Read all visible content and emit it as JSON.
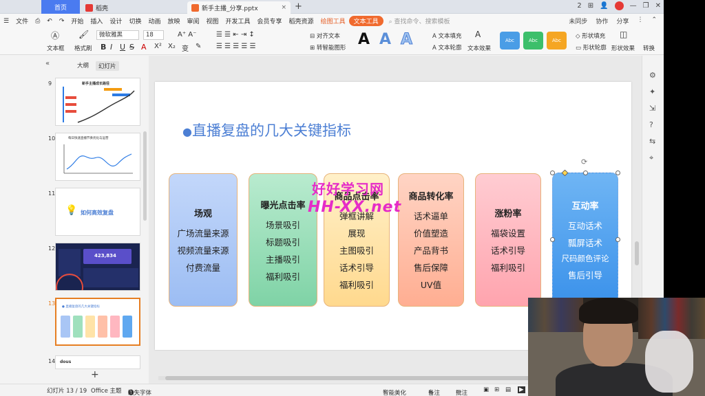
{
  "tabs": {
    "home": "首页",
    "daoke": "稻壳",
    "file": "新手主播_分享.pptx"
  },
  "titlebar_right": [
    "2",
    "⊞"
  ],
  "menu": {
    "file": "文件",
    "items": [
      "开始",
      "插入",
      "设计",
      "切换",
      "动画",
      "放映",
      "审阅",
      "视图",
      "开发工具",
      "会员专享",
      "稻壳资源"
    ],
    "draw_tools": "绘图工具",
    "text_tools": "文本工具",
    "search": "查找命令、搜索模板",
    "unsynced": "未同步",
    "collab": "协作",
    "share": "分享"
  },
  "ribbon": {
    "textbox": "文本框",
    "format_brush": "格式刷",
    "font_name": "微软雅黑",
    "font_size": "18",
    "align_text": "对齐文本",
    "smartart": "转智能图形",
    "text_fill": "文本填充",
    "text_outline": "文本轮廓",
    "text_effect": "文本效果",
    "abc": "Abc",
    "shape_fill": "形状填充",
    "shape_outline": "形状轮廓",
    "shape_effect": "形状效果",
    "convert": "转换",
    "bold": "B",
    "italic": "I",
    "underline": "U",
    "strike": "S",
    "fontcolor": "A",
    "superscript": "X²",
    "subscript": "X₂",
    "bigA": "A"
  },
  "leftpanel": {
    "outline_tab": "大纲",
    "slides_tab": "幻灯片",
    "slides": [
      {
        "num": "9",
        "title": "新手主播成长路径"
      },
      {
        "num": "10",
        "title": "每日快速直播节奏优化与运营"
      },
      {
        "num": "11",
        "title": "如何高效复盘"
      },
      {
        "num": "12",
        "title": "423,834"
      },
      {
        "num": "13",
        "title": "● 直播复盘的几大关键指标"
      },
      {
        "num": "14",
        "title": "dous"
      }
    ]
  },
  "slide": {
    "title": "直播复盘的几大关键指标",
    "cards": [
      {
        "title": "场观",
        "items": [
          "广场流量来源",
          "视频流量来源",
          "付费流量"
        ],
        "color": "#a9c6f5",
        "color2": "#7ea6ea"
      },
      {
        "title": "曝光点击率",
        "items": [
          "场景吸引",
          "标题吸引",
          "主播吸引",
          "福利吸引"
        ],
        "color": "#9fe0bd",
        "color2": "#5fc892"
      },
      {
        "title": "商品点击率",
        "items": [
          "弹框讲解",
          "展现",
          "主图吸引",
          "话术引导",
          "福利吸引"
        ],
        "color": "#ffe3a8",
        "color2": "#ffc96b"
      },
      {
        "title": "商品转化率",
        "items": [
          "话术逼单",
          "价值塑造",
          "产品背书",
          "售后保障",
          "UV值"
        ],
        "color": "#ffc0a8",
        "color2": "#ff9a7a"
      },
      {
        "title": "涨粉率",
        "items": [
          "福袋设置",
          "话术引导",
          "福利吸引"
        ],
        "color": "#ffb7c0",
        "color2": "#ff8e99"
      },
      {
        "title": "互动率",
        "items": [
          "互动话术",
          "瓢屏话术",
          "尺码颜色评论",
          "售后引导"
        ],
        "color": "#5fa8f0",
        "color2": "#2f86e6"
      }
    ],
    "watermark1": "好好学习网",
    "watermark2": "HH-XX.net"
  },
  "status": {
    "slide_count": "幻灯片 13 / 19",
    "theme": "Office 主题",
    "missing_font": "缺失字体",
    "beautify": "智能美化",
    "notes": "备注",
    "comments": "批注"
  }
}
